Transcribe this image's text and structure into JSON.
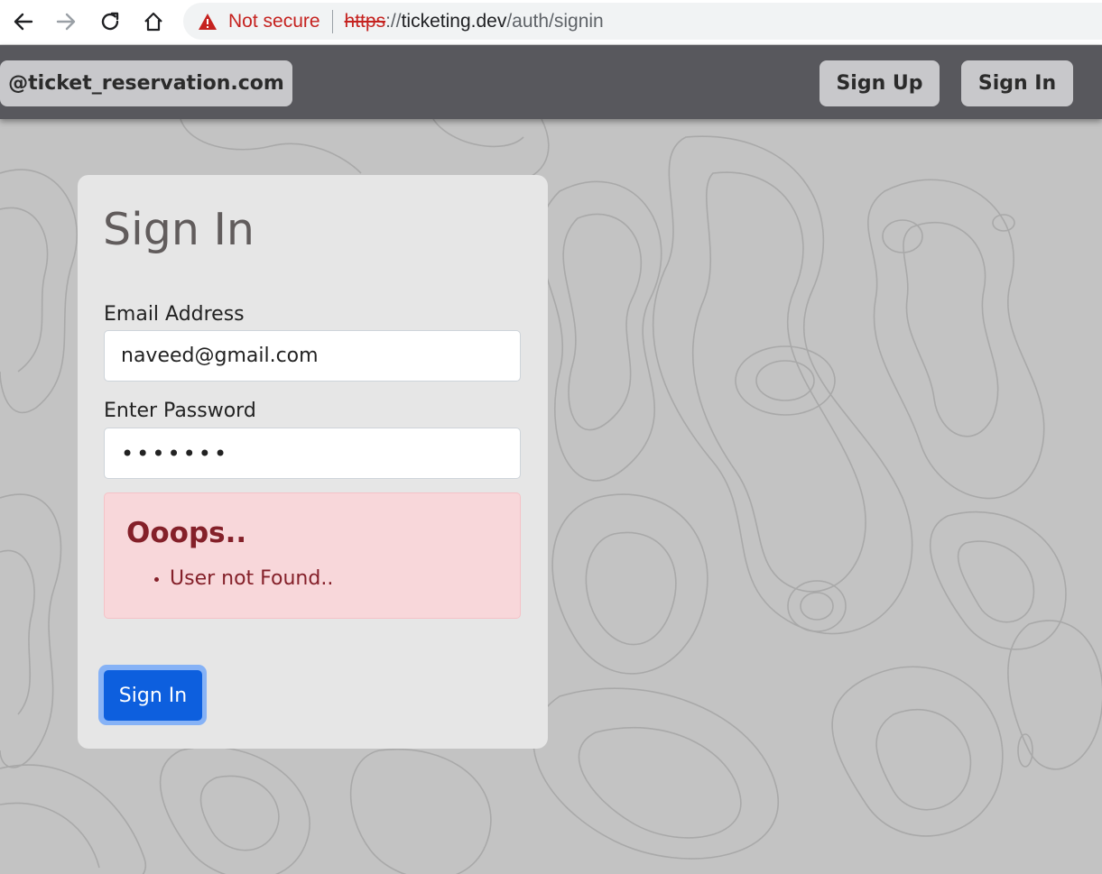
{
  "browser": {
    "back_icon": "arrow-left-icon",
    "forward_icon": "arrow-right-icon",
    "reload_icon": "reload-icon",
    "home_icon": "home-icon",
    "security_label": "Not secure",
    "url_scheme": "https",
    "url_separator": "://",
    "url_host": "ticketing.dev",
    "url_path": "/auth/signin"
  },
  "header": {
    "brand": "@ticket_reservation.com",
    "signup_label": "Sign Up",
    "signin_label": "Sign In"
  },
  "form": {
    "title": "Sign In",
    "email_label": "Email Address",
    "email_value": "naveed@gmail.com",
    "password_label": "Enter Password",
    "password_value": "•••••••",
    "submit_label": "Sign In"
  },
  "error": {
    "title": "Ooops..",
    "messages": [
      "User not Found.."
    ]
  },
  "colors": {
    "header_bg": "#58585d",
    "primary": "#0d5fde",
    "danger_text": "#842029",
    "danger_bg": "#f8d7da"
  }
}
